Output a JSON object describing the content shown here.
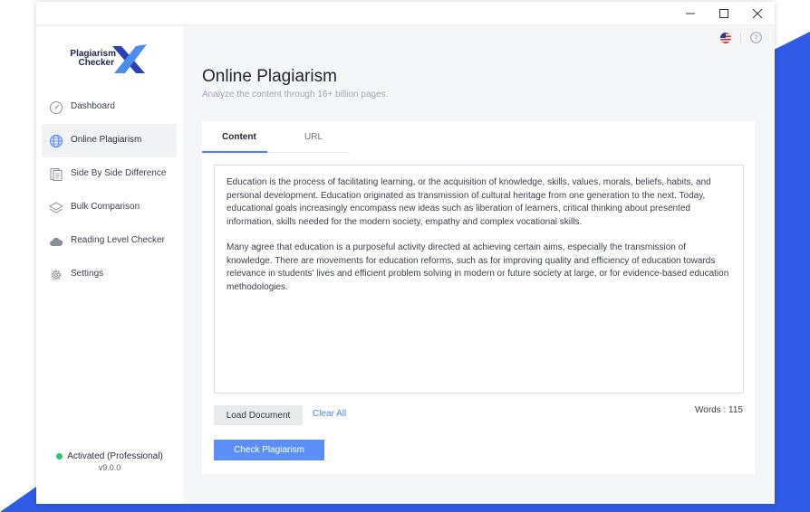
{
  "window": {
    "minimize_icon": "minimize-icon",
    "maximize_icon": "maximize-icon",
    "close_icon": "close-icon"
  },
  "logo": {
    "line1": "Plagiarism",
    "line2": "Checker",
    "mark": "X",
    "colors": {
      "primary": "#2b3fb8",
      "accent": "#4a8cf0"
    }
  },
  "sidebar": {
    "items": [
      {
        "label": "Dashboard",
        "icon": "gauge-icon",
        "active": false
      },
      {
        "label": "Online Plagiarism",
        "icon": "globe-icon",
        "active": true
      },
      {
        "label": "Side By Side Difference",
        "icon": "document-compare-icon",
        "active": false
      },
      {
        "label": "Bulk Comparison",
        "icon": "layers-icon",
        "active": false
      },
      {
        "label": "Reading Level Checker",
        "icon": "cloud-icon",
        "active": false
      },
      {
        "label": "Settings",
        "icon": "gear-icon",
        "active": false
      }
    ],
    "status": {
      "text": "Activated (Professional)",
      "color": "#28c76f"
    },
    "version": "v9.0.0"
  },
  "topbar": {
    "flag_icon": "us-flag-icon",
    "help_icon": "help-icon"
  },
  "main": {
    "title": "Online Plagiarism",
    "subtitle": "Analyze the content through 16+ billion pages.",
    "tabs": [
      {
        "label": "Content",
        "active": true
      },
      {
        "label": "URL",
        "active": false
      }
    ],
    "content": {
      "paragraph1": "Education is the process of facilitating learning, or the acquisition of knowledge, skills, values, morals, beliefs, habits, and personal development. Education originated as transmission of cultural heritage from one generation to the next. Today, educational goals increasingly encompass new ideas such as liberation of learners, critical thinking about presented information, skills needed for the modern society, empathy and complex vocational skills.",
      "paragraph2": "Many agree that education is a purposeful activity directed at achieving certain aims, especially the transmission of knowledge. There are movements for education reforms, such as for improving quality and efficiency of education towards relevance in students' lives and efficient problem solving in modern or future society at large, or for evidence-based education methodologies."
    },
    "load_button": "Load Document",
    "clear_link": "Clear All",
    "words": "Words : 115",
    "check_button": "Check Plagiarism",
    "accent_color": "#4a7ff5"
  }
}
